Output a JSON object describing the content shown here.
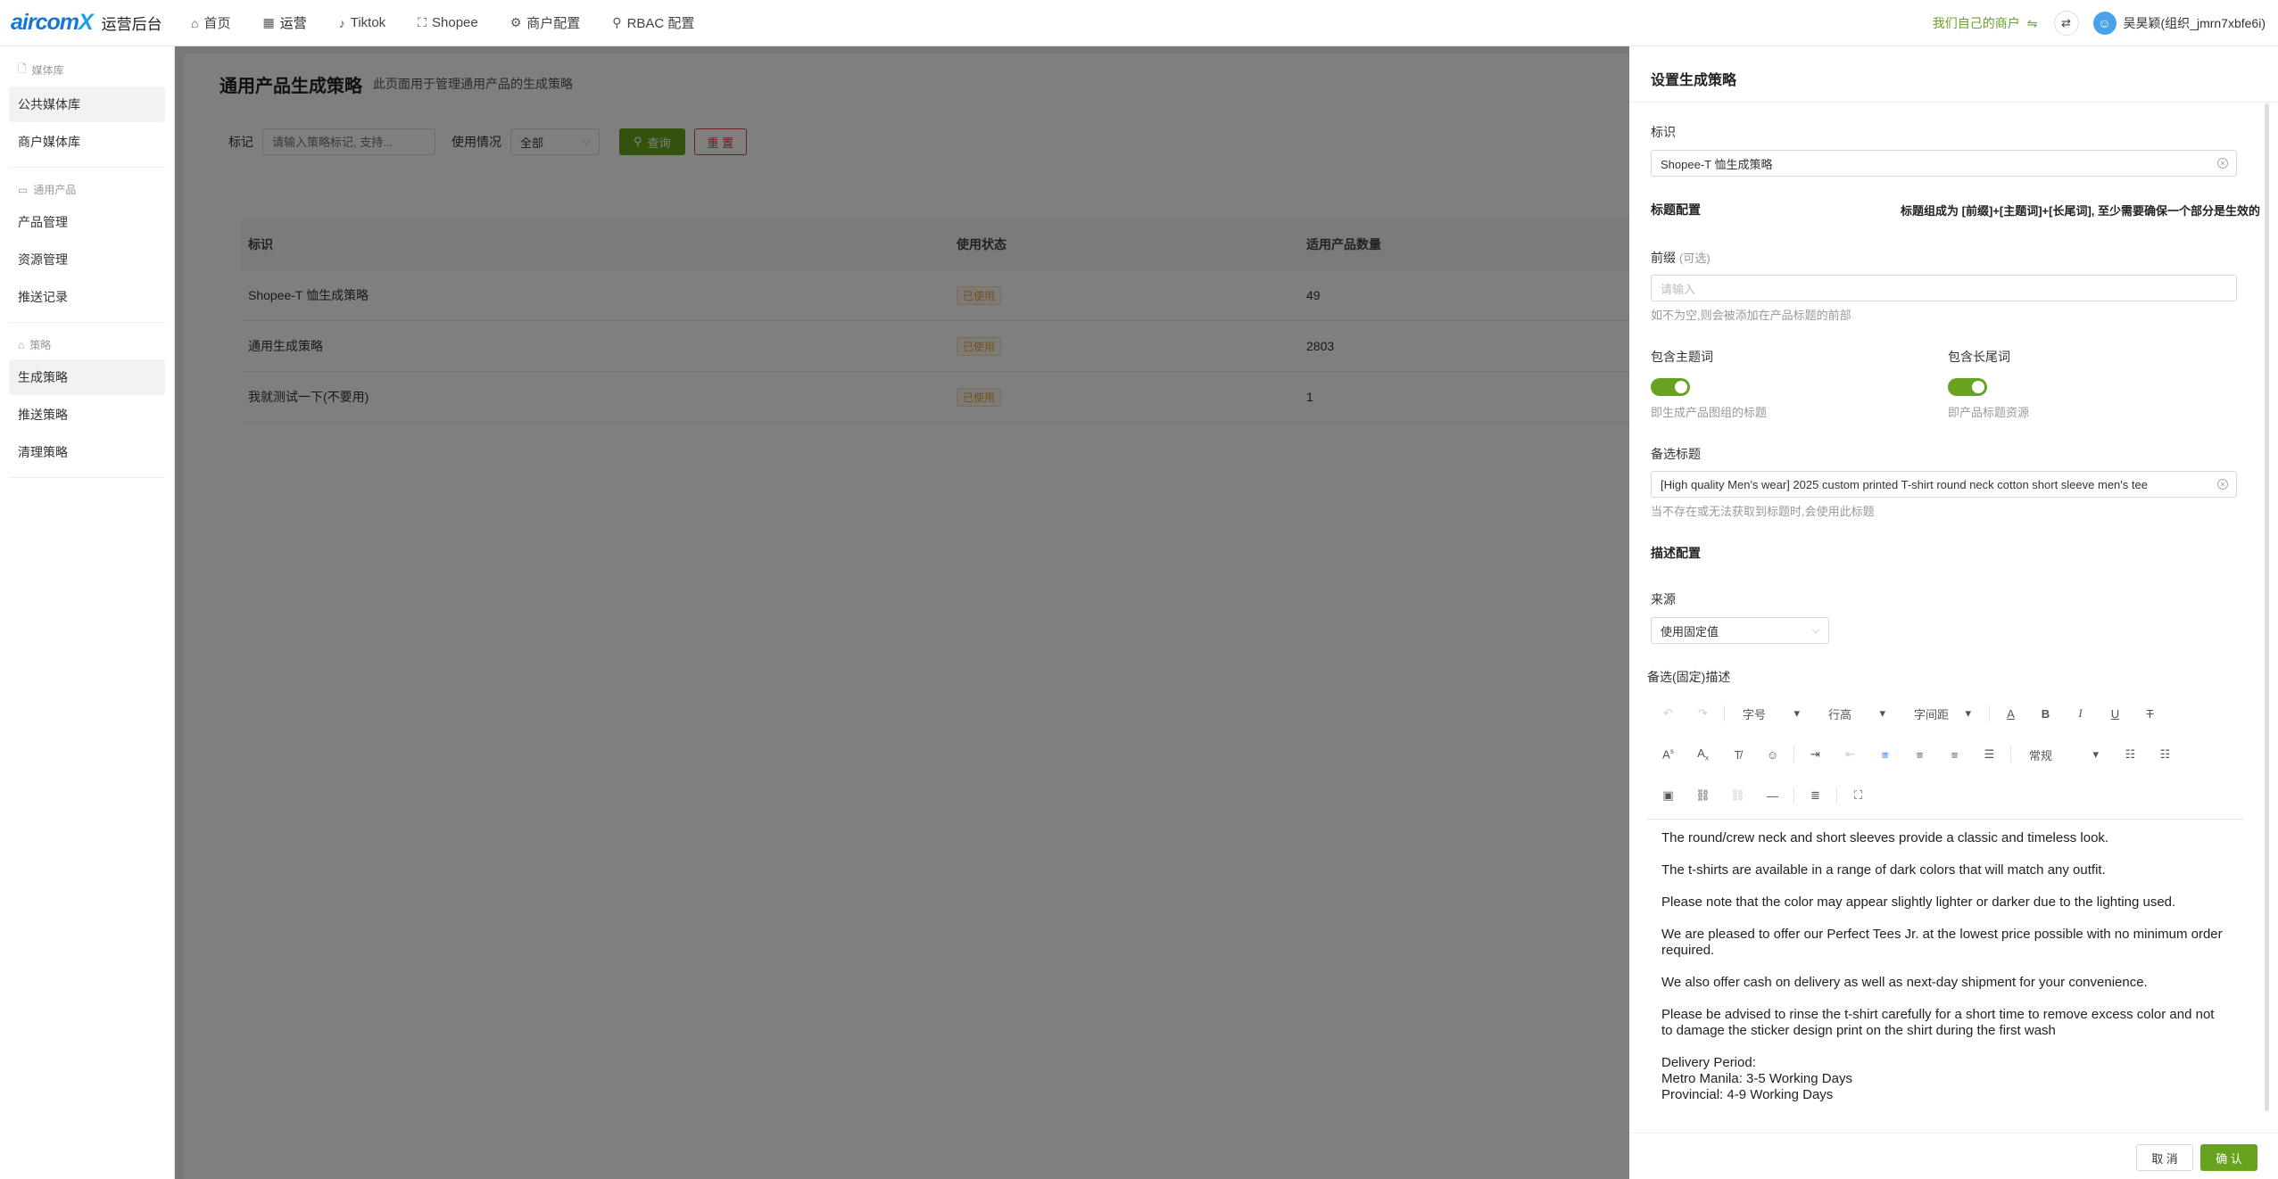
{
  "header": {
    "logo_text": "aircom",
    "logo_x": "X",
    "app_title": "运营后台",
    "nav": [
      {
        "label": "首页",
        "icon": "home-icon"
      },
      {
        "label": "运营",
        "icon": "dashboard-icon"
      },
      {
        "label": "Tiktok",
        "icon": "tiktok-icon"
      },
      {
        "label": "Shopee",
        "icon": "shopee-icon"
      },
      {
        "label": "商户配置",
        "icon": "gear-icon"
      },
      {
        "label": "RBAC 配置",
        "icon": "key-icon"
      }
    ],
    "merchant": "我们自己的商户",
    "username": "吴昊颖(组织_jmrn7xbfe6i)"
  },
  "sidebar": {
    "groups": [
      {
        "title": "媒体库",
        "items": [
          "公共媒体库",
          "商户媒体库"
        ]
      },
      {
        "title": "通用产品",
        "items": [
          "产品管理",
          "资源管理",
          "推送记录"
        ]
      },
      {
        "title": "策略",
        "items": [
          "生成策略",
          "推送策略",
          "清理策略"
        ]
      }
    ]
  },
  "main": {
    "title": "通用产品生成策略",
    "description": "此页面用于管理通用产品的生成策略",
    "filter": {
      "mark_label": "标记",
      "mark_placeholder": "请输入策略标记, 支持...",
      "usage_label": "使用情况",
      "usage_value": "全部",
      "query_label": "查询",
      "reset_label": "重 置"
    },
    "table": {
      "columns": [
        "标识",
        "使用状态",
        "适用产品数量"
      ],
      "rows": [
        {
          "name": "Shopee-T 恤生成策略",
          "status": "已使用",
          "count": "49"
        },
        {
          "name": "通用生成策略",
          "status": "已使用",
          "count": "2803"
        },
        {
          "name": "我就测试一下(不要用)",
          "status": "已使用",
          "count": "1"
        }
      ]
    }
  },
  "drawer": {
    "title": "设置生成策略",
    "id_label": "标识",
    "id_value": "Shopee-T 恤生成策略",
    "title_section": "标题配置",
    "title_note": "标题组成为 [前缀]+[主题词]+[长尾词], 至少需要确保一个部分是生效的",
    "prefix_label": "前缀",
    "prefix_optional": "(可选)",
    "prefix_placeholder": "请输入",
    "prefix_hint": "如不为空,则会被添加在产品标题的前部",
    "theme_label": "包含主题词",
    "theme_hint": "即生成产品图组的标题",
    "longtail_label": "包含长尾词",
    "longtail_hint": "即产品标题资源",
    "alt_title_label": "备选标题",
    "alt_title_value": "[High quality Men's wear] 2025 custom printed T-shirt round neck cotton short sleeve men's tee",
    "alt_title_hint": "当不存在或无法获取到标题时,会使用此标题",
    "desc_section": "描述配置",
    "source_label": "来源",
    "source_value": "使用固定值",
    "alt_desc_label": "备选(固定)描述",
    "toolbar": {
      "font_size": "字号",
      "line_height": "行高",
      "letter_spacing": "字间距",
      "paragraph": "常规"
    },
    "editor_paragraphs": [
      "The round/crew neck and short sleeves provide a classic and timeless look.",
      "The t-shirts are available in a range of dark colors that will match any outfit.",
      "Please note that the color may appear slightly lighter or darker due to the lighting used.",
      "We are pleased to offer our Perfect Tees Jr. at the lowest price possible with no minimum order required.",
      "We also offer cash on delivery as well as next-day shipment for your convenience.",
      "Please be advised to rinse the t-shirt carefully for a short time to remove excess color and not to damage the sticker design print on the shirt during the first wash"
    ],
    "delivery_lines": [
      "Delivery Period:",
      "Metro Manila: 3-5 Working Days",
      "Provincial: 4-9 Working Days"
    ],
    "cancel_label": "取 消",
    "confirm_label": "确 认"
  },
  "colors": {
    "accent": "#67a31f",
    "danger": "#e23b3b",
    "badge": "#e6a23c"
  }
}
